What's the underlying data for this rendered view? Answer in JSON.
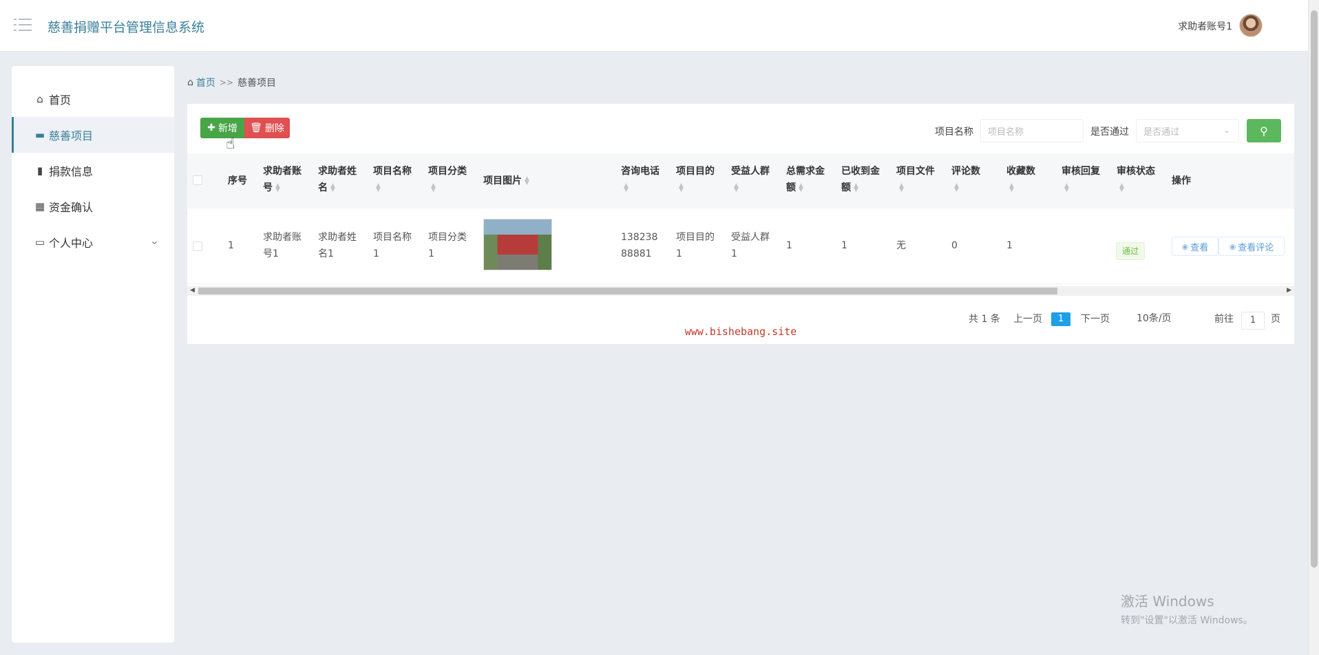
{
  "header": {
    "app_title": "慈善捐赠平台管理信息系统",
    "user_name": "求助者账号1",
    "menu_icon": "hamburger-icon",
    "avatar_icon": "user-avatar"
  },
  "sidebar": {
    "items": [
      {
        "label": "首页",
        "icon": "home-icon"
      },
      {
        "label": "慈善项目",
        "icon": "monitor-icon",
        "active": true
      },
      {
        "label": "捐款信息",
        "icon": "book-icon"
      },
      {
        "label": "资金确认",
        "icon": "grid-icon"
      },
      {
        "label": "个人中心",
        "icon": "card-icon",
        "has_children": true
      }
    ]
  },
  "breadcrumb": {
    "home": "首页",
    "separator": ">>",
    "current": "慈善项目"
  },
  "toolbar": {
    "add_label": "新增",
    "delete_label": "删除",
    "search_name_label": "项目名称",
    "search_name_placeholder": "项目名称",
    "search_status_label": "是否通过",
    "search_status_placeholder": "是否通过",
    "search_icon": "search-icon"
  },
  "table": {
    "columns": [
      {
        "key": "index",
        "label": "序号"
      },
      {
        "key": "account",
        "label": "求助者账号"
      },
      {
        "key": "name",
        "label": "求助者姓名"
      },
      {
        "key": "project_name",
        "label": "项目名称"
      },
      {
        "key": "category",
        "label": "项目分类"
      },
      {
        "key": "image",
        "label": "项目图片"
      },
      {
        "key": "phone",
        "label": "咨询电话"
      },
      {
        "key": "purpose",
        "label": "项目目的"
      },
      {
        "key": "beneficiary",
        "label": "受益人群"
      },
      {
        "key": "total_needed",
        "label": "总需求金额"
      },
      {
        "key": "received",
        "label": "已收到金额"
      },
      {
        "key": "file",
        "label": "项目文件"
      },
      {
        "key": "comments",
        "label": "评论数"
      },
      {
        "key": "favorites",
        "label": "收藏数"
      },
      {
        "key": "review_reply",
        "label": "审核回复"
      },
      {
        "key": "review_status",
        "label": "审核状态"
      },
      {
        "key": "actions",
        "label": "操作"
      }
    ],
    "rows": [
      {
        "index": "1",
        "account": "求助者账号1",
        "name": "求助者姓名1",
        "project_name": "项目名称1",
        "category": "项目分类1",
        "image": "project-photo",
        "phone": "13823888881",
        "purpose": "项目目的1",
        "beneficiary": "受益人群1",
        "total_needed": "1",
        "received": "1",
        "file": "无",
        "comments": "0",
        "favorites": "1",
        "review_reply": "",
        "review_status": "通过",
        "actions": [
          "查看",
          "查看评论"
        ]
      }
    ]
  },
  "pagination": {
    "total_text": "共 1 条",
    "prev": "上一页",
    "current": "1",
    "next": "下一页",
    "page_size": "10条/页",
    "goto_prefix": "前往",
    "goto_value": "1",
    "goto_suffix": "页"
  },
  "watermark": "www.bishebang.site",
  "windows_activation": {
    "line1": "激活 Windows",
    "line2": "转到\"设置\"以激活 Windows。"
  },
  "colors": {
    "accent": "#3a7f9a",
    "add": "#47a447",
    "delete": "#e05050",
    "search": "#5cb85c",
    "page_active": "#1f9fe8"
  }
}
